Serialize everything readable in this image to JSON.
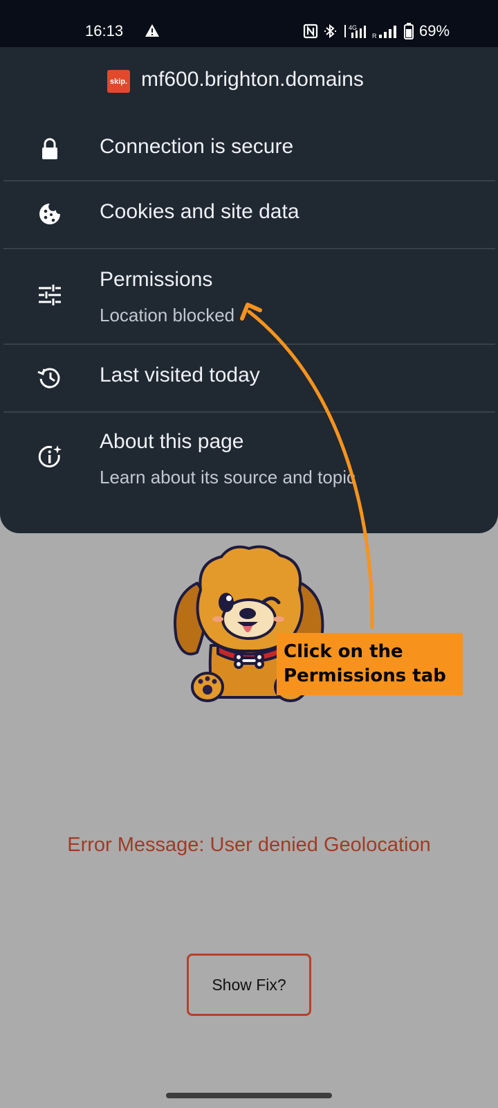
{
  "status_bar": {
    "time": "16:13",
    "network_label": "4G",
    "roaming_label": "R",
    "battery_percent": "69%"
  },
  "site_info": {
    "logo_text": "skip.",
    "domain": "mf600.brighton.domains",
    "items": [
      {
        "label": "Connection is secure",
        "subtitle": "",
        "icon": "lock-icon"
      },
      {
        "label": "Cookies and site data",
        "subtitle": "",
        "icon": "cookie-icon"
      },
      {
        "label": "Permissions",
        "subtitle": "Location blocked",
        "icon": "tune-sliders-icon"
      },
      {
        "label": "Last visited today",
        "subtitle": "",
        "icon": "history-icon"
      },
      {
        "label": "About this page",
        "subtitle": "Learn about its source and topic",
        "icon": "info-sparkle-icon"
      }
    ]
  },
  "page": {
    "error_message": "Error Message: User denied Geolocation",
    "show_fix_label": "Show Fix?"
  },
  "annotation": {
    "callout_line1": "Click on the",
    "callout_line2": "Permissions tab",
    "callout_color": "#f7931d"
  },
  "colors": {
    "sheet_background": "#202832",
    "page_background": "#ababab",
    "error_text": "#a03b25"
  }
}
